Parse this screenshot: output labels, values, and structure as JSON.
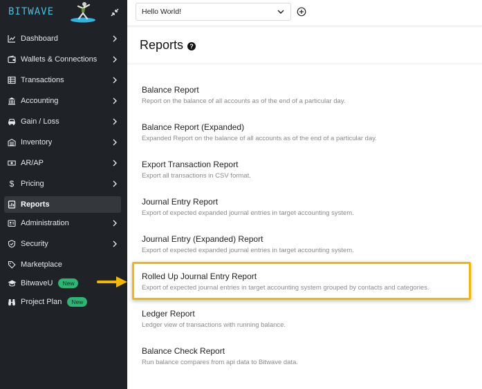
{
  "brand": {
    "name": "BITWAVE"
  },
  "sidebar": {
    "items": [
      {
        "label": "Dashboard",
        "icon": "chart-line-icon",
        "chevron": true
      },
      {
        "label": "Wallets & Connections",
        "icon": "wallet-icon",
        "chevron": true
      },
      {
        "label": "Transactions",
        "icon": "table-icon",
        "chevron": true
      },
      {
        "label": "Accounting",
        "icon": "bank-icon",
        "chevron": true
      },
      {
        "label": "Gain / Loss",
        "icon": "car-icon",
        "chevron": true
      },
      {
        "label": "Inventory",
        "icon": "warehouse-icon",
        "chevron": true
      },
      {
        "label": "AR/AP",
        "icon": "money-icon",
        "chevron": true
      },
      {
        "label": "Pricing",
        "icon": "dollar-icon",
        "chevron": true
      },
      {
        "label": "Reports",
        "icon": "report-icon",
        "chevron": false,
        "active": true
      },
      {
        "label": "Administration",
        "icon": "admin-icon",
        "chevron": true
      },
      {
        "label": "Security",
        "icon": "shield-icon",
        "chevron": true
      },
      {
        "label": "Marketplace",
        "icon": "tag-icon",
        "chevron": false
      },
      {
        "label": "BitwaveU",
        "icon": "graduation-cap-icon",
        "chevron": false,
        "badge": "New"
      },
      {
        "label": "Project Plan",
        "icon": "binoculars-icon",
        "chevron": false,
        "badge": "New"
      }
    ]
  },
  "topbar": {
    "org_value": "Hello World!"
  },
  "page": {
    "title": "Reports"
  },
  "reports": [
    {
      "title": "Balance Report",
      "description": "Report on the balance of all accounts as of the end of a particular day."
    },
    {
      "title": "Balance Report (Expanded)",
      "description": "Expanded Report on the balance of all accounts as of the end of a particular day."
    },
    {
      "title": "Export Transaction Report",
      "description": "Export all transactions in CSV format."
    },
    {
      "title": "Journal Entry Report",
      "description": "Export of expected expanded journal entries in target accounting system."
    },
    {
      "title": "Journal Entry (Expanded) Report",
      "description": "Export of expected expanded journal entries in target accounting system."
    },
    {
      "title": "Rolled Up Journal Entry Report",
      "description": "Export of expected journal entries in target accounting system grouped by contacts and categories.",
      "highlighted": true
    },
    {
      "title": "Ledger Report",
      "description": "Ledger view of transactions with running balance."
    },
    {
      "title": "Balance Check Report",
      "description": "Run balance compares from api data to Bitwave data."
    }
  ],
  "colors": {
    "sidebar_bg": "#1f2226",
    "brand": "#3ec3e8",
    "highlight": "#f5b800",
    "badge": "#2bb673"
  }
}
